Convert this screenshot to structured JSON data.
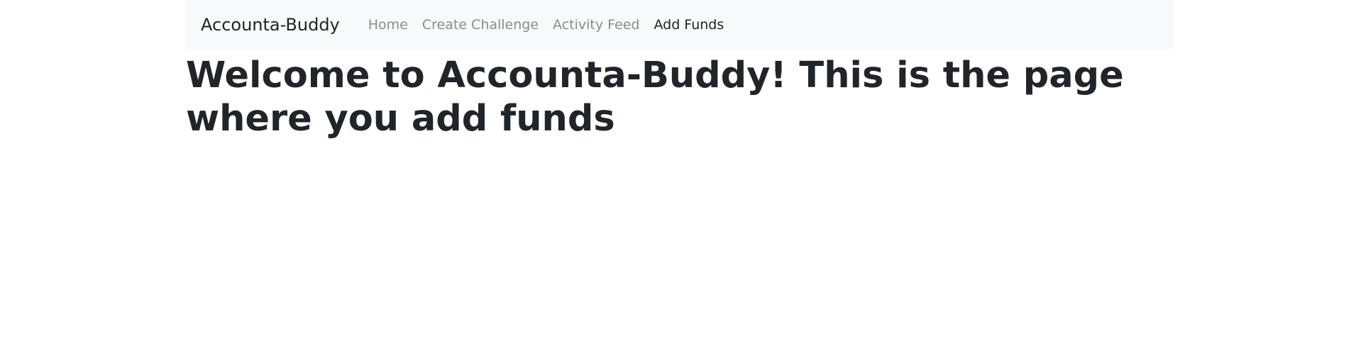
{
  "navbar": {
    "brand": "Accounta-Buddy",
    "links": [
      {
        "label": "Home",
        "active": false
      },
      {
        "label": "Create Challenge",
        "active": false
      },
      {
        "label": "Activity Feed",
        "active": false
      },
      {
        "label": "Add Funds",
        "active": true
      }
    ]
  },
  "main": {
    "heading": "Welcome to Accounta-Buddy! This is the page where you add funds"
  },
  "colors": {
    "navbar_bg": "#f8f9fa",
    "text": "#212529",
    "muted_link": "#8a8d90"
  }
}
